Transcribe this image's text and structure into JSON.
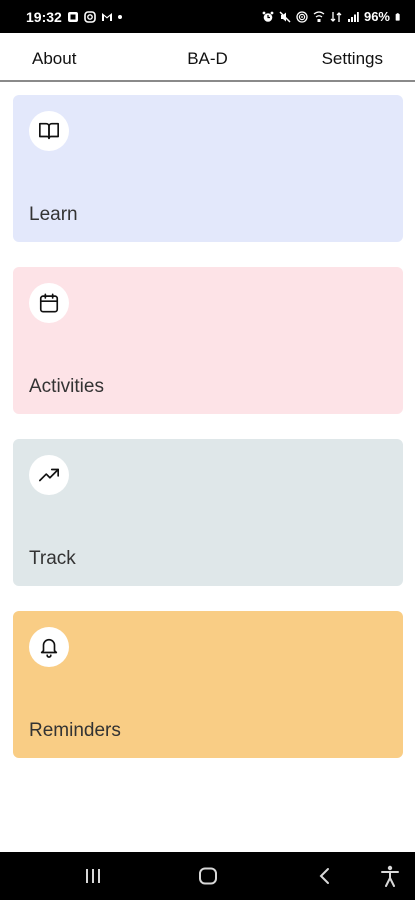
{
  "status_bar": {
    "time": "19:32",
    "battery": "96%",
    "left_icons": [
      "notification-icon",
      "instagram-icon",
      "gmail-icon"
    ],
    "right_icons": [
      "alarm-icon",
      "mute-icon",
      "hotspot-icon",
      "wifi-call-icon",
      "data-icon",
      "signal-icon",
      "battery-icon"
    ]
  },
  "nav": {
    "about": "About",
    "title": "BA-D",
    "settings": "Settings"
  },
  "cards": [
    {
      "label": "Learn",
      "icon": "book-icon",
      "color": "#e3e8fb"
    },
    {
      "label": "Activities",
      "icon": "calendar-icon",
      "color": "#fde3e7"
    },
    {
      "label": "Track",
      "icon": "trending-up-icon",
      "color": "#dfe7e9"
    },
    {
      "label": "Reminders",
      "icon": "bell-icon",
      "color": "#f9cd85"
    }
  ],
  "system_nav": {
    "icons": [
      "recents-icon",
      "home-icon",
      "back-icon",
      "accessibility-icon"
    ]
  }
}
